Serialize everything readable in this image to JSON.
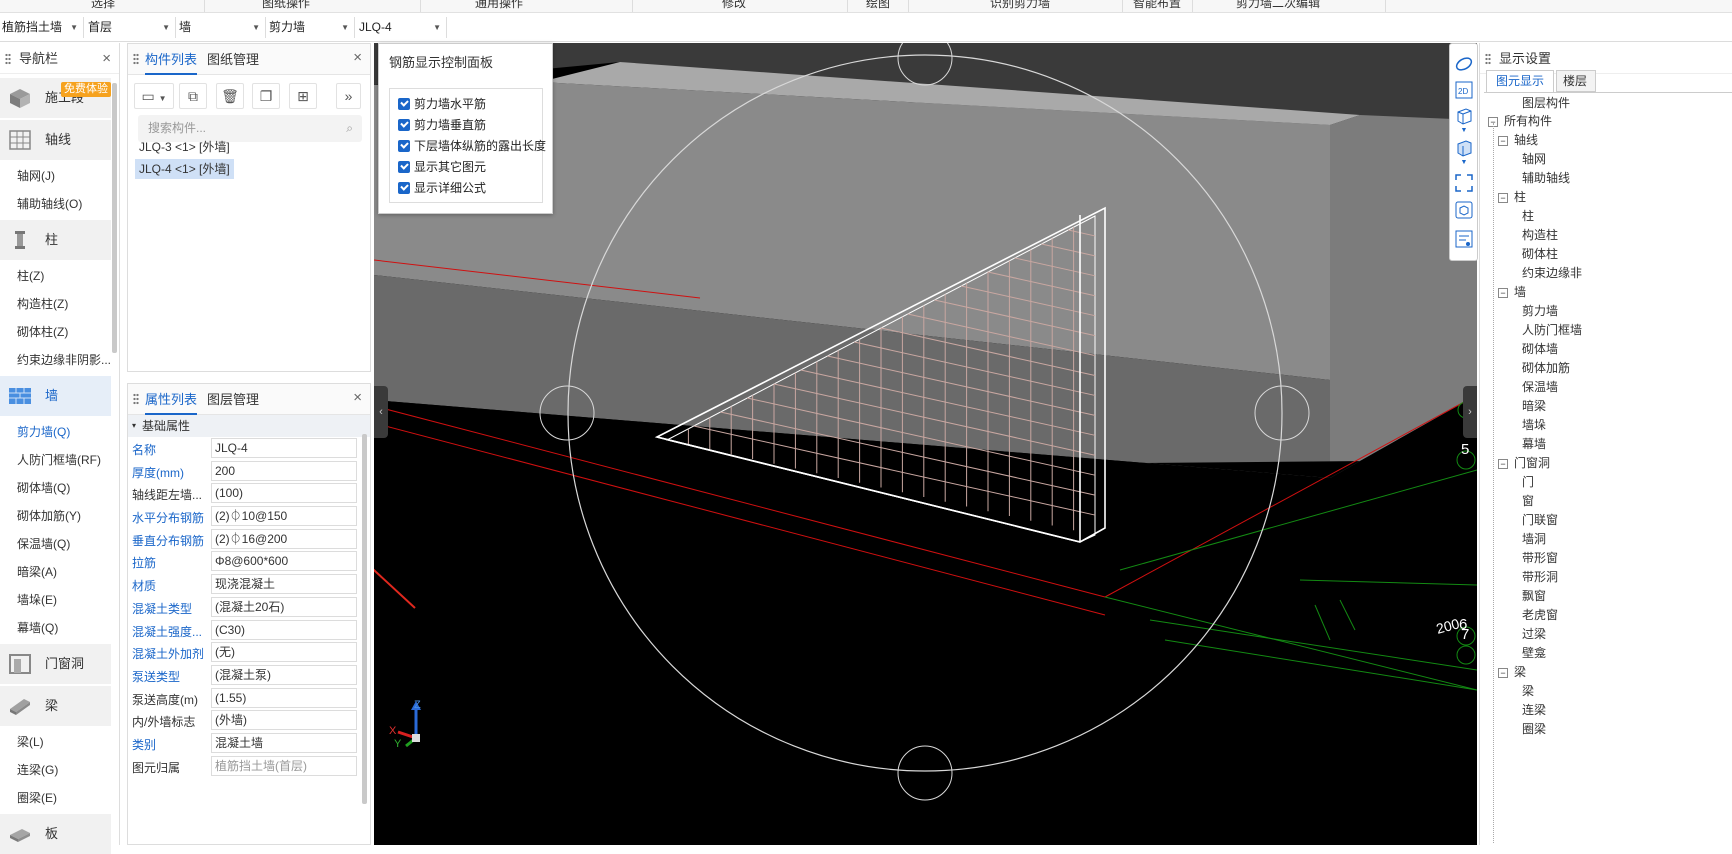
{
  "topbar": {
    "items": [
      "选择",
      "图纸操作",
      "通用操作",
      "修改",
      "绘图",
      "识别剪力墙",
      "智能布置",
      "剪力墙二次编辑"
    ]
  },
  "selectors": {
    "project": "植筋挡土墙",
    "floor": "首层",
    "category": "墙",
    "type": "剪力墙",
    "component": "JLQ-4"
  },
  "nav": {
    "title": "导航栏",
    "badge": "免费体验",
    "groups": [
      {
        "label": "施工段",
        "icon": "construction-section-icon"
      },
      {
        "label": "轴线",
        "icon": "axis-grid-icon",
        "items": [
          "轴网(J)",
          "辅助轴线(O)"
        ]
      },
      {
        "label": "柱",
        "icon": "column-icon",
        "items": [
          "柱(Z)",
          "构造柱(Z)",
          "砌体柱(Z)",
          "约束边缘非阴影..."
        ]
      },
      {
        "label": "墙",
        "icon": "wall-icon",
        "items": [
          "剪力墙(Q)",
          "人防门框墙(RF)",
          "砌体墙(Q)",
          "砌体加筋(Y)",
          "保温墙(Q)",
          "暗梁(A)",
          "墙垛(E)",
          "幕墙(Q)"
        ]
      },
      {
        "label": "门窗洞",
        "icon": "door-window-icon"
      },
      {
        "label": "梁",
        "icon": "beam-icon",
        "items": [
          "梁(L)",
          "连梁(G)",
          "圈梁(E)"
        ]
      },
      {
        "label": "板",
        "icon": "slab-icon"
      }
    ]
  },
  "component_panel": {
    "tabs": [
      "构件列表",
      "图纸管理"
    ],
    "search_placeholder": "搜索构件...",
    "items": [
      "JLQ-3 <1> [外墙]",
      "JLQ-4 <1> [外墙]"
    ]
  },
  "property_panel": {
    "tabs": [
      "属性列表",
      "图层管理"
    ],
    "section": "基础属性",
    "rows": [
      {
        "key": "名称",
        "value": "JLQ-4"
      },
      {
        "key": "厚度(mm)",
        "value": "200"
      },
      {
        "key": "轴线距左墙...",
        "value": "(100)"
      },
      {
        "key": "水平分布钢筋",
        "value": "(2)⏀10@150"
      },
      {
        "key": "垂直分布钢筋",
        "value": "(2)⏀16@200"
      },
      {
        "key": "拉筋",
        "value": "Φ8@600*600"
      },
      {
        "key": "材质",
        "value": "现浇混凝土"
      },
      {
        "key": "混凝土类型",
        "value": "(混凝土20石)"
      },
      {
        "key": "混凝土强度...",
        "value": "(C30)"
      },
      {
        "key": "混凝土外加剂",
        "value": "(无)"
      },
      {
        "key": "泵送类型",
        "value": "(混凝土泵)"
      },
      {
        "key": "泵送高度(m)",
        "value": "(1.55)"
      },
      {
        "key": "内/外墙标志",
        "value": "(外墙)"
      },
      {
        "key": "类别",
        "value": "混凝土墙"
      },
      {
        "key": "图元归属",
        "value": "植筋挡土墙(首层)"
      }
    ]
  },
  "rebar_panel": {
    "title": "钢筋显示控制面板",
    "options": [
      "剪力墙水平筋",
      "剪力墙垂直筋",
      "下层墙体纵筋的露出长度",
      "显示其它图元",
      "显示详细公式"
    ]
  },
  "viewport": {
    "axis_labels": {
      "x": "X",
      "y": "Y",
      "z": "Z"
    },
    "grid_labels": [
      "5",
      "6",
      "7"
    ],
    "dimension": "200"
  },
  "display_settings": {
    "title": "显示设置",
    "tabs": [
      "图元显示",
      "楼层"
    ],
    "column_header": "图层构件",
    "tree": [
      {
        "label": "所有构件",
        "level": 0,
        "group": true
      },
      {
        "label": "轴线",
        "level": 1,
        "group": true
      },
      {
        "label": "轴网",
        "level": 2
      },
      {
        "label": "辅助轴线",
        "level": 2
      },
      {
        "label": "柱",
        "level": 1,
        "group": true
      },
      {
        "label": "柱",
        "level": 2
      },
      {
        "label": "构造柱",
        "level": 2
      },
      {
        "label": "砌体柱",
        "level": 2
      },
      {
        "label": "约束边缘非",
        "level": 2
      },
      {
        "label": "墙",
        "level": 1,
        "group": true
      },
      {
        "label": "剪力墙",
        "level": 2
      },
      {
        "label": "人防门框墙",
        "level": 2
      },
      {
        "label": "砌体墙",
        "level": 2
      },
      {
        "label": "砌体加筋",
        "level": 2
      },
      {
        "label": "保温墙",
        "level": 2
      },
      {
        "label": "暗梁",
        "level": 2
      },
      {
        "label": "墙垛",
        "level": 2
      },
      {
        "label": "幕墙",
        "level": 2
      },
      {
        "label": "门窗洞",
        "level": 1,
        "group": true
      },
      {
        "label": "门",
        "level": 2
      },
      {
        "label": "窗",
        "level": 2
      },
      {
        "label": "门联窗",
        "level": 2
      },
      {
        "label": "墙洞",
        "level": 2
      },
      {
        "label": "带形窗",
        "level": 2
      },
      {
        "label": "带形洞",
        "level": 2
      },
      {
        "label": "飘窗",
        "level": 2
      },
      {
        "label": "老虎窗",
        "level": 2
      },
      {
        "label": "过梁",
        "level": 2
      },
      {
        "label": "壁龛",
        "level": 2
      },
      {
        "label": "梁",
        "level": 1,
        "group": true
      },
      {
        "label": "梁",
        "level": 2
      },
      {
        "label": "连梁",
        "level": 2
      },
      {
        "label": "圈梁",
        "level": 2
      }
    ]
  },
  "colors": {
    "accent": "#1a66c9",
    "viewport_bg": "#000000",
    "wall_gray": "#8a8a8a",
    "axis_red": "#d01010",
    "axis_green": "#138a13",
    "badge": "#f6a21e"
  }
}
